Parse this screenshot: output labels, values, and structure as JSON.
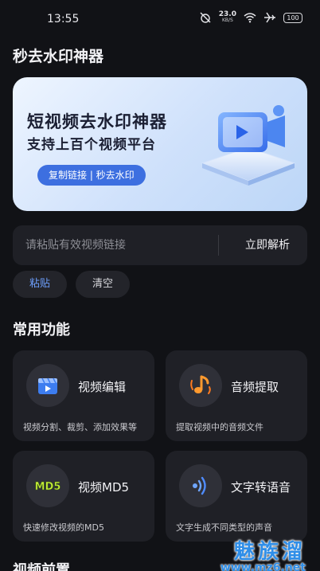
{
  "status_bar": {
    "time": "13:55",
    "net_speed_value": "23.0",
    "net_speed_unit": "KB/S",
    "battery": "100",
    "icons": [
      "alarm-off-icon",
      "wifi-icon",
      "airplane-icon",
      "battery-icon"
    ]
  },
  "app": {
    "title": "秒去水印神器"
  },
  "banner": {
    "line1": "短视频去水印神器",
    "line2": "支持上百个视频平台",
    "chip": "复制链接 | 秒去水印",
    "colors": {
      "gradient_start": "#eef5ff",
      "gradient_end": "#bcd6f7",
      "chip": "#3d6fe0"
    }
  },
  "url_input": {
    "placeholder": "请粘贴有效视频链接",
    "value": "",
    "action_label": "立即解析"
  },
  "actions": {
    "paste": "粘贴",
    "clear": "清空"
  },
  "section": {
    "title": "常用功能"
  },
  "features": [
    {
      "title": "视频编辑",
      "desc": "视频分割、裁剪、添加效果等",
      "icon": "video-edit-icon"
    },
    {
      "title": "音频提取",
      "desc": "提取视频中的音频文件",
      "icon": "music-note-icon"
    },
    {
      "title": "视频MD5",
      "desc": "快速修改视频的MD5",
      "icon": "md5-icon",
      "icon_text": "MD5"
    },
    {
      "title": "文字转语音",
      "desc": "文字生成不同类型的声音",
      "icon": "sound-wave-icon"
    }
  ],
  "bottom": {
    "heading": "视频前置"
  },
  "watermark": {
    "big": "魅族溜",
    "small": "www.mz6.net"
  },
  "colors": {
    "background": "#111216",
    "card": "#1f2026",
    "accent": "#6ea0ff"
  }
}
